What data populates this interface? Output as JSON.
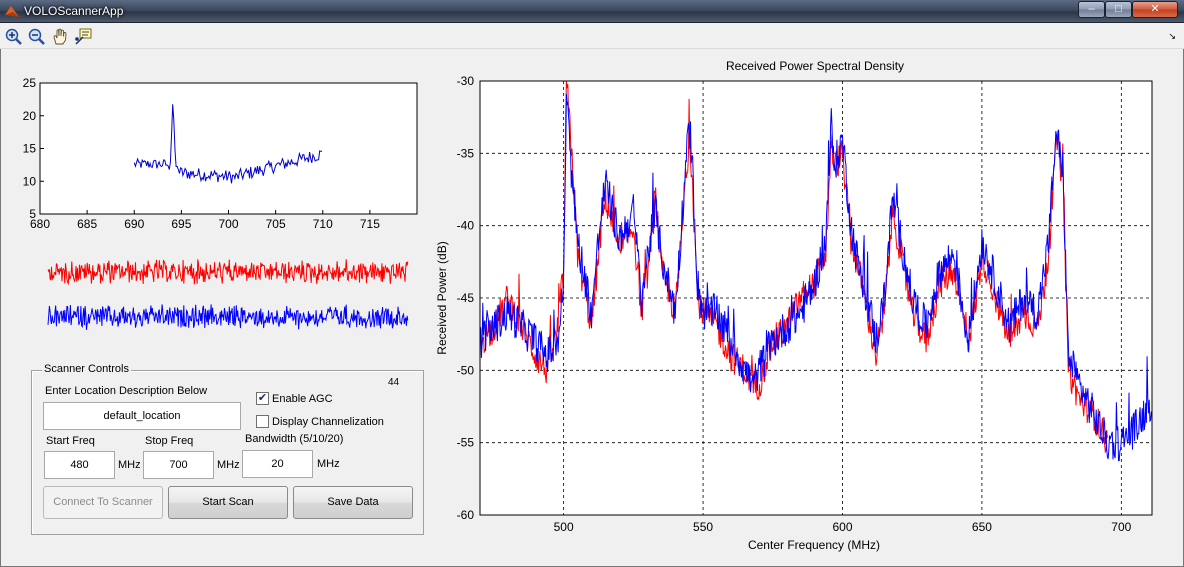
{
  "window": {
    "title": "VOLOScannerApp",
    "controls": {
      "minimize": "–",
      "maximize": "□",
      "close": "✕"
    }
  },
  "toolbar": {
    "tools": [
      "zoom-in-icon",
      "zoom-out-icon",
      "pan-hand-icon",
      "data-cursor-icon"
    ],
    "dock_glyph": "↘"
  },
  "small_plot": {
    "xlim": [
      680,
      720
    ],
    "ylim": [
      5,
      25
    ],
    "x_ticks": [
      "680",
      "685",
      "690",
      "695",
      "700",
      "705",
      "710",
      "715"
    ],
    "y_ticks": [
      "25",
      "20",
      "15",
      "10",
      "5"
    ],
    "line_color": "#0000cc",
    "x_range": [
      690,
      710
    ],
    "peak_at": 694.1,
    "peak_value": 22
  },
  "signal_strips": {
    "colors": [
      "#ff0000",
      "#0000ff"
    ]
  },
  "main_plot": {
    "title": "Received Power Spectral Density",
    "xlabel": "Center Frequency (MHz)",
    "ylabel": "Received Power (dB)",
    "x_ticks": [
      "500",
      "550",
      "600",
      "650",
      "700"
    ],
    "y_ticks": [
      "-30",
      "-35",
      "-40",
      "-45",
      "-50",
      "-55",
      "-60"
    ]
  },
  "chart_data": {
    "type": "line",
    "title": "Received Power Spectral Density",
    "xlabel": "Center Frequency (MHz)",
    "ylabel": "Received Power (dB)",
    "xlim": [
      470,
      711
    ],
    "ylim": [
      -60,
      -30
    ],
    "grid": true,
    "series": [
      {
        "color": "#0000ff",
        "x": [
          470,
          475,
          480,
          485,
          490,
          494,
          498,
          500,
          501,
          503,
          505,
          510,
          513,
          515,
          520,
          525,
          528,
          531,
          533,
          535,
          540,
          543,
          545,
          546,
          548,
          550,
          555,
          560,
          565,
          568,
          570,
          575,
          580,
          585,
          590,
          594,
          596,
          597,
          600,
          603,
          607,
          610,
          612,
          615,
          618,
          620,
          625,
          630,
          635,
          640,
          645,
          648,
          650,
          655,
          660,
          665,
          670,
          674,
          676,
          677,
          679,
          681,
          685,
          690,
          695,
          700,
          705,
          711
        ],
        "y": [
          -48,
          -47,
          -46,
          -47,
          -48,
          -49,
          -48,
          -44,
          -31,
          -37,
          -41,
          -46,
          -40,
          -37,
          -41,
          -39,
          -45,
          -41,
          -39,
          -42,
          -46,
          -38,
          -33,
          -35,
          -44,
          -46,
          -46,
          -48,
          -50,
          -51,
          -50,
          -48,
          -47,
          -46,
          -44,
          -41,
          -33,
          -36,
          -34,
          -40,
          -44,
          -46,
          -48,
          -45,
          -38,
          -40,
          -45,
          -47,
          -43,
          -42,
          -48,
          -44,
          -41,
          -44,
          -47,
          -45,
          -46,
          -41,
          -35,
          -34,
          -36,
          -49,
          -51,
          -53,
          -55,
          -55,
          -54,
          -52
        ]
      },
      {
        "color": "#ff0000",
        "x": [
          470,
          475,
          480,
          485,
          490,
          494,
          498,
          500,
          501,
          503,
          505,
          510,
          513,
          515,
          520,
          525,
          528,
          531,
          533,
          535,
          540,
          543,
          545,
          546,
          548,
          550,
          555,
          560,
          565,
          568,
          570,
          575,
          580,
          585,
          590,
          594,
          596,
          597,
          600,
          603,
          607,
          610,
          612,
          615,
          618,
          620,
          625,
          630,
          635,
          640,
          645,
          648,
          650,
          655,
          660,
          665,
          670,
          674,
          676,
          677,
          679,
          681,
          685,
          690,
          695
        ],
        "y": [
          -48,
          -47,
          -45,
          -47,
          -49,
          -50,
          -47,
          -43,
          -30,
          -35,
          -42,
          -47,
          -41,
          -38,
          -42,
          -40,
          -46,
          -42,
          -38,
          -43,
          -46,
          -39,
          -34,
          -36,
          -45,
          -46,
          -47,
          -49,
          -50,
          -51,
          -51,
          -48,
          -47,
          -45,
          -44,
          -42,
          -34,
          -36,
          -35,
          -41,
          -44,
          -47,
          -49,
          -46,
          -39,
          -41,
          -46,
          -48,
          -44,
          -43,
          -48,
          -45,
          -42,
          -45,
          -48,
          -46,
          -47,
          -42,
          -36,
          -34,
          -37,
          -50,
          -52,
          -53,
          -55
        ]
      }
    ]
  },
  "scanner_controls": {
    "title": "Scanner Controls",
    "counter": "44",
    "location_label": "Enter Location Description Below",
    "location_value": "default_location",
    "enable_agc_label": "Enable AGC",
    "enable_agc_checked": true,
    "display_channelization_label": "Display Channelization",
    "display_channelization_checked": false,
    "check_glyph": "✔",
    "start_freq_label": "Start Freq",
    "start_freq_value": "480",
    "stop_freq_label": "Stop Freq",
    "stop_freq_value": "700",
    "bandwidth_label": "Bandwidth (5/10/20)",
    "bandwidth_value": "20",
    "unit_mhz": "MHz",
    "connect_label": "Connect To Scanner",
    "start_scan_label": "Start Scan",
    "save_data_label": "Save Data"
  }
}
